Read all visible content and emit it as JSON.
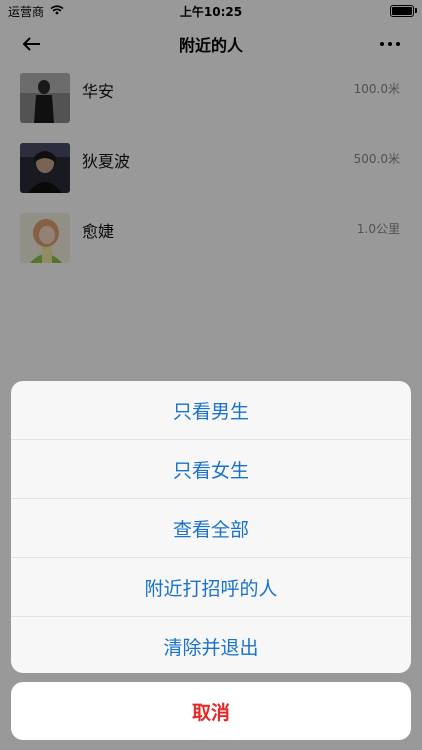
{
  "status_bar": {
    "carrier": "运营商",
    "time": "上午10:25"
  },
  "navbar": {
    "title": "附近的人"
  },
  "people": [
    {
      "name": "华安",
      "distance": "100.0米"
    },
    {
      "name": "狄夏波",
      "distance": "500.0米"
    },
    {
      "name": "愈婕",
      "distance": "1.0公里"
    }
  ],
  "action_sheet": {
    "items": [
      "只看男生",
      "只看女生",
      "查看全部",
      "附近打招呼的人",
      "清除并退出"
    ],
    "cancel_label": "取消"
  },
  "colors": {
    "action_text": "#1a73c8",
    "cancel_text": "#e32a2a",
    "overlay": "rgba(0,0,0,0.40)"
  },
  "icons": {
    "back": "arrow-left-icon",
    "more": "more-dots-icon",
    "wifi": "wifi-icon",
    "battery": "battery-icon"
  }
}
